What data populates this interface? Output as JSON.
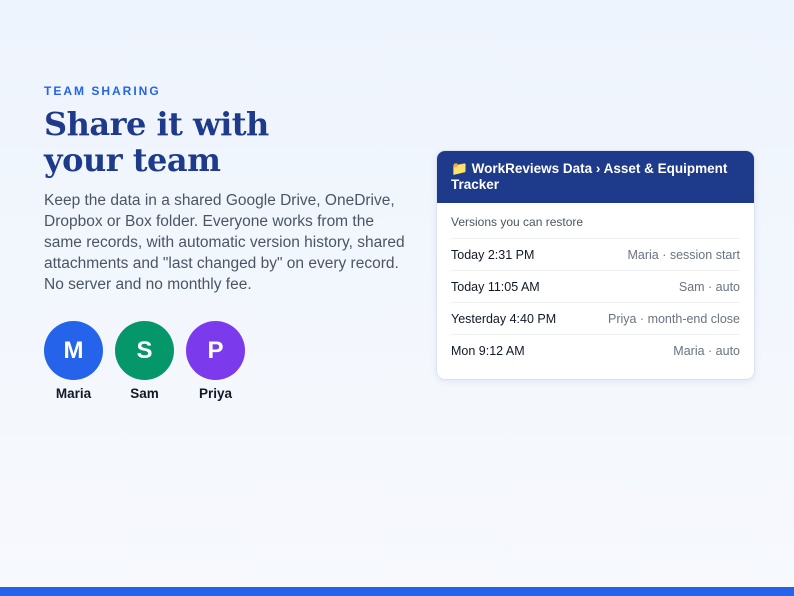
{
  "section": {
    "eyebrow": "TEAM SHARING",
    "title": "Share it with your team",
    "description": "Keep the data in a shared Google Drive, OneDrive, Dropbox or Box folder. Everyone works from the same records, with automatic version history, shared attachments and \"last changed by\" on every record. No server and no monthly fee."
  },
  "avatars": [
    {
      "initial": "M",
      "name": "Maria",
      "color": "#2563eb"
    },
    {
      "initial": "S",
      "name": "Sam",
      "color": "#059669"
    },
    {
      "initial": "P",
      "name": "Priya",
      "color": "#7c3aed"
    }
  ],
  "card": {
    "header_icon": "folder-icon",
    "header_glyph": "📁",
    "header_title": "WorkReviews Data › Asset & Equipment Tracker",
    "subtitle": "Versions you can restore",
    "versions": [
      {
        "when": "Today 2:31 PM",
        "who": "Maria · session start"
      },
      {
        "when": "Today 11:05 AM",
        "who": "Sam · auto"
      },
      {
        "when": "Yesterday 4:40 PM",
        "who": "Priya · month-end close"
      },
      {
        "when": "Mon 9:12 AM",
        "who": "Maria · auto"
      }
    ]
  },
  "colors": {
    "accent": "#2563eb",
    "title": "#1e3a8a",
    "card_header": "#1e3a8a"
  }
}
